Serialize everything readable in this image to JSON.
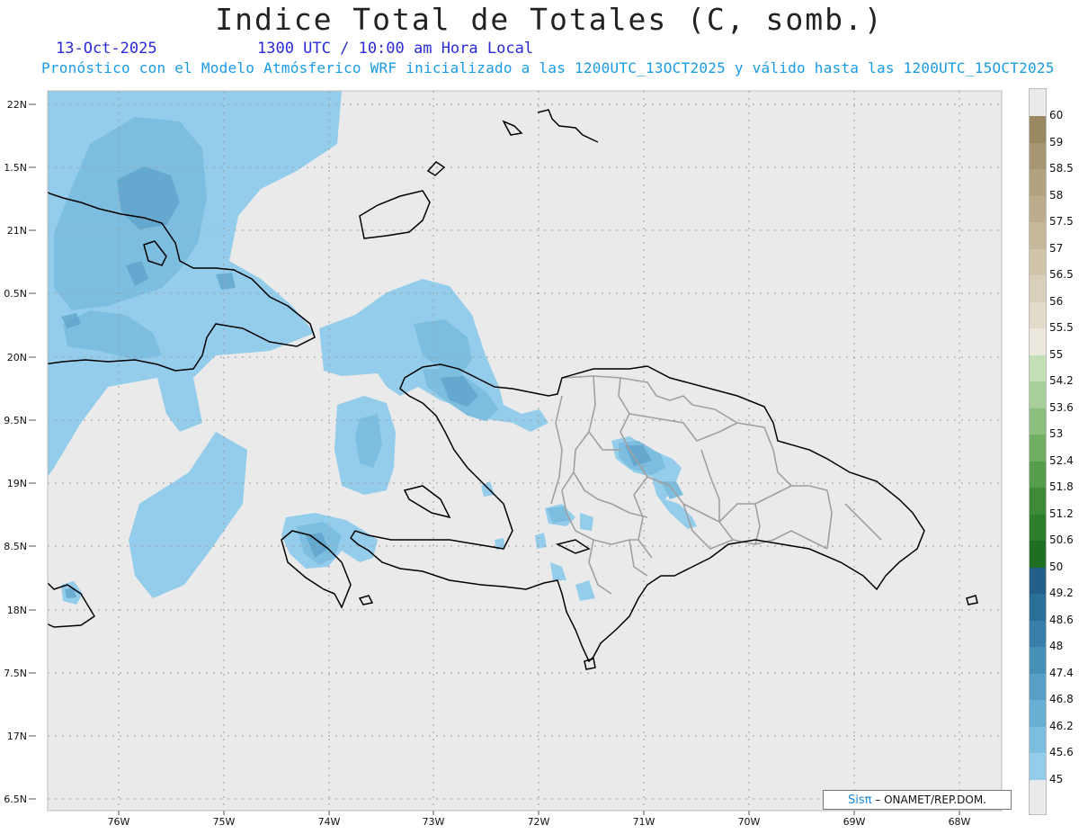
{
  "header": {
    "title": "Indice Total de Totales (C, somb.)",
    "date": "13-Oct-2025",
    "time": "1300 UTC / 10:00 am Hora Local",
    "description": "Pronóstico con el Modelo Atmósferico WRF inicializado a las 1200UTC_13OCT2025 y válido hasta las  1200UTC_15OCT2025"
  },
  "axes": {
    "lat_labels": [
      "22N",
      "1.5N",
      "21N",
      "0.5N",
      "20N",
      "9.5N",
      "19N",
      "8.5N",
      "18N",
      "7.5N",
      "17N",
      "6.5N"
    ],
    "lon_labels": [
      "76W",
      "75W",
      "74W",
      "73W",
      "72W",
      "71W",
      "70W",
      "69W",
      "68W"
    ]
  },
  "colorbar": {
    "labels": [
      "60",
      "59",
      "58.5",
      "58",
      "57.5",
      "57",
      "56.5",
      "56",
      "55.5",
      "55",
      "54.2",
      "53.6",
      "53",
      "52.4",
      "51.8",
      "51.2",
      "50.6",
      "50",
      "49.2",
      "48.6",
      "48",
      "47.4",
      "46.8",
      "46.2",
      "45.6",
      "45"
    ],
    "colors": [
      "#9a8862",
      "#a89672",
      "#b3a27f",
      "#bcac8c",
      "#c6b89a",
      "#d0c5aa",
      "#d9d0bb",
      "#e3dccd",
      "#ede8dd",
      "#c3dfb7",
      "#a8cf9a",
      "#8bbf7e",
      "#70ae64",
      "#559c4b",
      "#3d8a37",
      "#2c7d2c",
      "#1f6e22",
      "#22608a",
      "#2b7099",
      "#3880a9",
      "#4690b8",
      "#579fc6",
      "#69aed3",
      "#7cbde0",
      "#93cdeb"
    ],
    "background": "#eaeaea"
  },
  "map": {
    "background": "#eaeaea",
    "shade_light": "#93cdeb",
    "shade_mid": "#7cbde0",
    "shade_dark": "#5b9fc8",
    "grid_color": "#9a9a9a",
    "coast_color": "#000000",
    "province_color": "#a0a0a0"
  },
  "credit": {
    "logo": "Sisπ",
    "text": "– ONAMET/REP.DOM."
  }
}
